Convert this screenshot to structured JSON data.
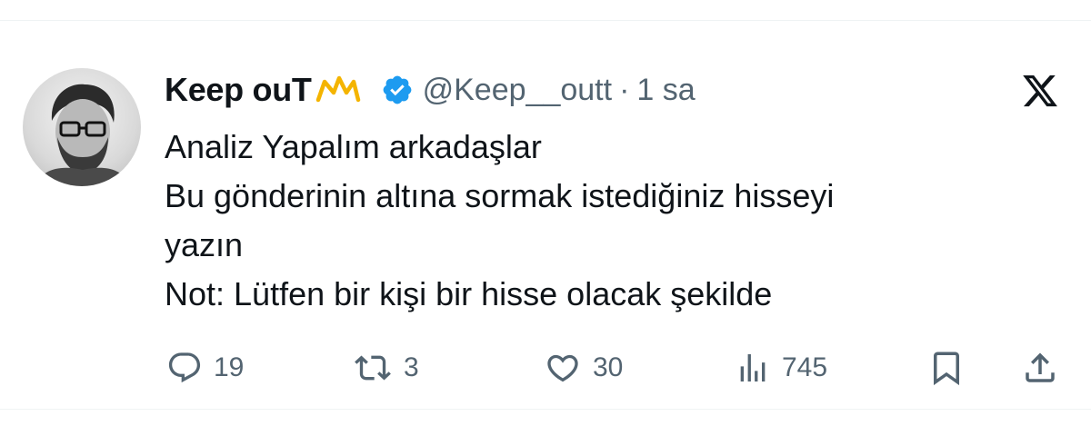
{
  "tweet": {
    "author": {
      "display_name": "Keep ouT",
      "name_emoji": "crown-emoji",
      "verified_icon": "verified-badge-icon",
      "handle": "@Keep__outt",
      "separator": "·",
      "time": "1 sa"
    },
    "text_lines": [
      "Analiz Yapalım arkadaşlar",
      "Bu gönderinin altına sormak istediğiniz hisseyi",
      "yazın",
      "Not: Lütfen bir kişi bir hisse olacak şekilde"
    ],
    "actions": {
      "reply": {
        "icon": "reply-icon",
        "count": "19"
      },
      "retweet": {
        "icon": "retweet-icon",
        "count": "3"
      },
      "like": {
        "icon": "heart-icon",
        "count": "30"
      },
      "views": {
        "icon": "views-icon",
        "count": "745"
      },
      "bookmark": {
        "icon": "bookmark-icon"
      },
      "share": {
        "icon": "share-icon"
      }
    },
    "brand_icon": "x-logo-icon"
  },
  "colors": {
    "text_primary": "#0f1419",
    "text_secondary": "#536471",
    "verified_blue": "#1d9bf0",
    "crown_gold": "#f4b400"
  }
}
